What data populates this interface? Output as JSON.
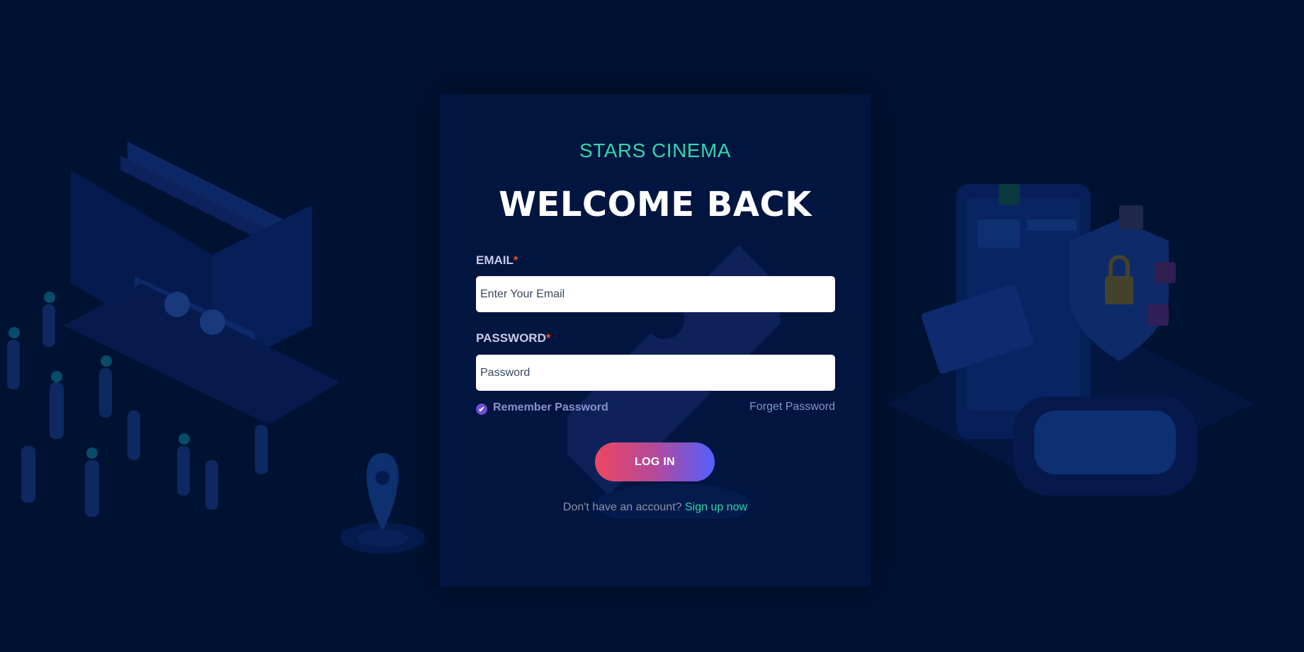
{
  "brand": "STARS CINEMA",
  "title": "WELCOME BACK",
  "email": {
    "label": "EMAIL",
    "required_mark": "*",
    "placeholder": "Enter Your Email",
    "value": ""
  },
  "password": {
    "label": "PASSWORD",
    "required_mark": "*",
    "placeholder": "Password",
    "value": ""
  },
  "remember": {
    "label": "Remember Password",
    "checked": true,
    "icon": "check-icon"
  },
  "forget_label": "Forget Password",
  "login_label": "LOG IN",
  "signup": {
    "prompt": "Don't have an account?",
    "link": "Sign up now"
  },
  "colors": {
    "page_bg": "#001232",
    "card_bg": "#001540",
    "brand": "#31d7a9",
    "required": "#f1481f",
    "button_gradient_start": "#ec4760",
    "button_gradient_end": "#5460fe"
  }
}
